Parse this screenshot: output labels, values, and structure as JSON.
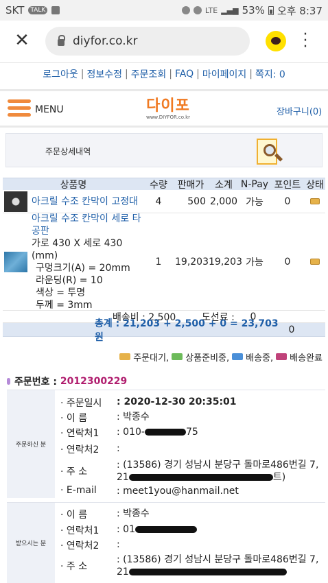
{
  "status_bar": {
    "carrier": "SKT",
    "talk_badge": "TALK",
    "network": "LTE",
    "battery": "53%",
    "time": "오후 8:37"
  },
  "browser": {
    "url": "diyfor.co.kr"
  },
  "top_links": [
    "로그아웃",
    "정보수정",
    "주문조회",
    "FAQ",
    "마이페이지",
    "쪽지: 0"
  ],
  "header": {
    "menu_label": "MENU",
    "logo_text": "다이포",
    "logo_sub": "www.DIYFOR.co.kr",
    "cart_label": "장바구니(0)"
  },
  "banner": {
    "title": "주문상세내역"
  },
  "table": {
    "headers": [
      "상품명",
      "수량",
      "판매가",
      "소계",
      "N-Pay",
      "포인트",
      "상태"
    ],
    "rows": [
      {
        "name": "아크릴 수조 칸막이 고정대",
        "options": [],
        "qty": "4",
        "price": "500",
        "subtotal": "2,000",
        "npay": "가능",
        "point": "0"
      },
      {
        "name": "아크릴 수조 칸막이 세로 타공판",
        "options": [
          "가로 430 X 세로 430 (mm)",
          "구멍크기(A) = 20mm",
          "라운딩(R) = 10",
          "색상 = 투명",
          "두께 = 3mm"
        ],
        "qty": "1",
        "price": "19,203",
        "subtotal": "19,203",
        "npay": "가능",
        "point": "0"
      }
    ],
    "shipping_label": "배송비 : 2,500",
    "toll_label": "도선료 :",
    "toll_value": "0",
    "total_text": "총계 : 21,203 + 2,500 + 0 = 23,703 원",
    "total_point": "0"
  },
  "legend": [
    {
      "label": "주문대기,",
      "color": "#e6b24a"
    },
    {
      "label": "상품준비중,",
      "color": "#6dbb5a"
    },
    {
      "label": "배송중,",
      "color": "#4a8fd8"
    },
    {
      "label": "배송완료",
      "color": "#c0427a"
    }
  ],
  "order": {
    "label": "주문번호 :",
    "number": "2012300229"
  },
  "orderer": {
    "section_label": "주문하신 분",
    "fields": {
      "date_label": "· 주문일시",
      "date_value": ": 2020-12-30 20:35:01",
      "name_label": "· 이 름",
      "name_value": ": 박종수",
      "phone1_label": "· 연락처1",
      "phone1_value": ": 010-",
      "phone1_tail": "75",
      "phone2_label": "· 연락처2",
      "phone2_value": ":",
      "addr_label": "· 주 소",
      "addr_value": ": (13586) 경기 성남시 분당구 돌마로486번길 7,",
      "addr_line2_head": "21",
      "addr_line2_tail": "트)",
      "email_label": "· E-mail",
      "email_value": ": meet1you@hanmail.net"
    }
  },
  "receiver": {
    "section_label": "받으시는 분",
    "fields": {
      "name_label": "· 이 름",
      "name_value": ": 박종수",
      "phone1_label": "· 연락처1",
      "phone1_value": ": 01",
      "phone2_label": "· 연락처2",
      "phone2_value": ":",
      "addr_label": "· 주 소",
      "addr_value": ": (13586) 경기 성남시 분당구 돌마로486번길 7,",
      "addr_line2_head": "21"
    }
  }
}
